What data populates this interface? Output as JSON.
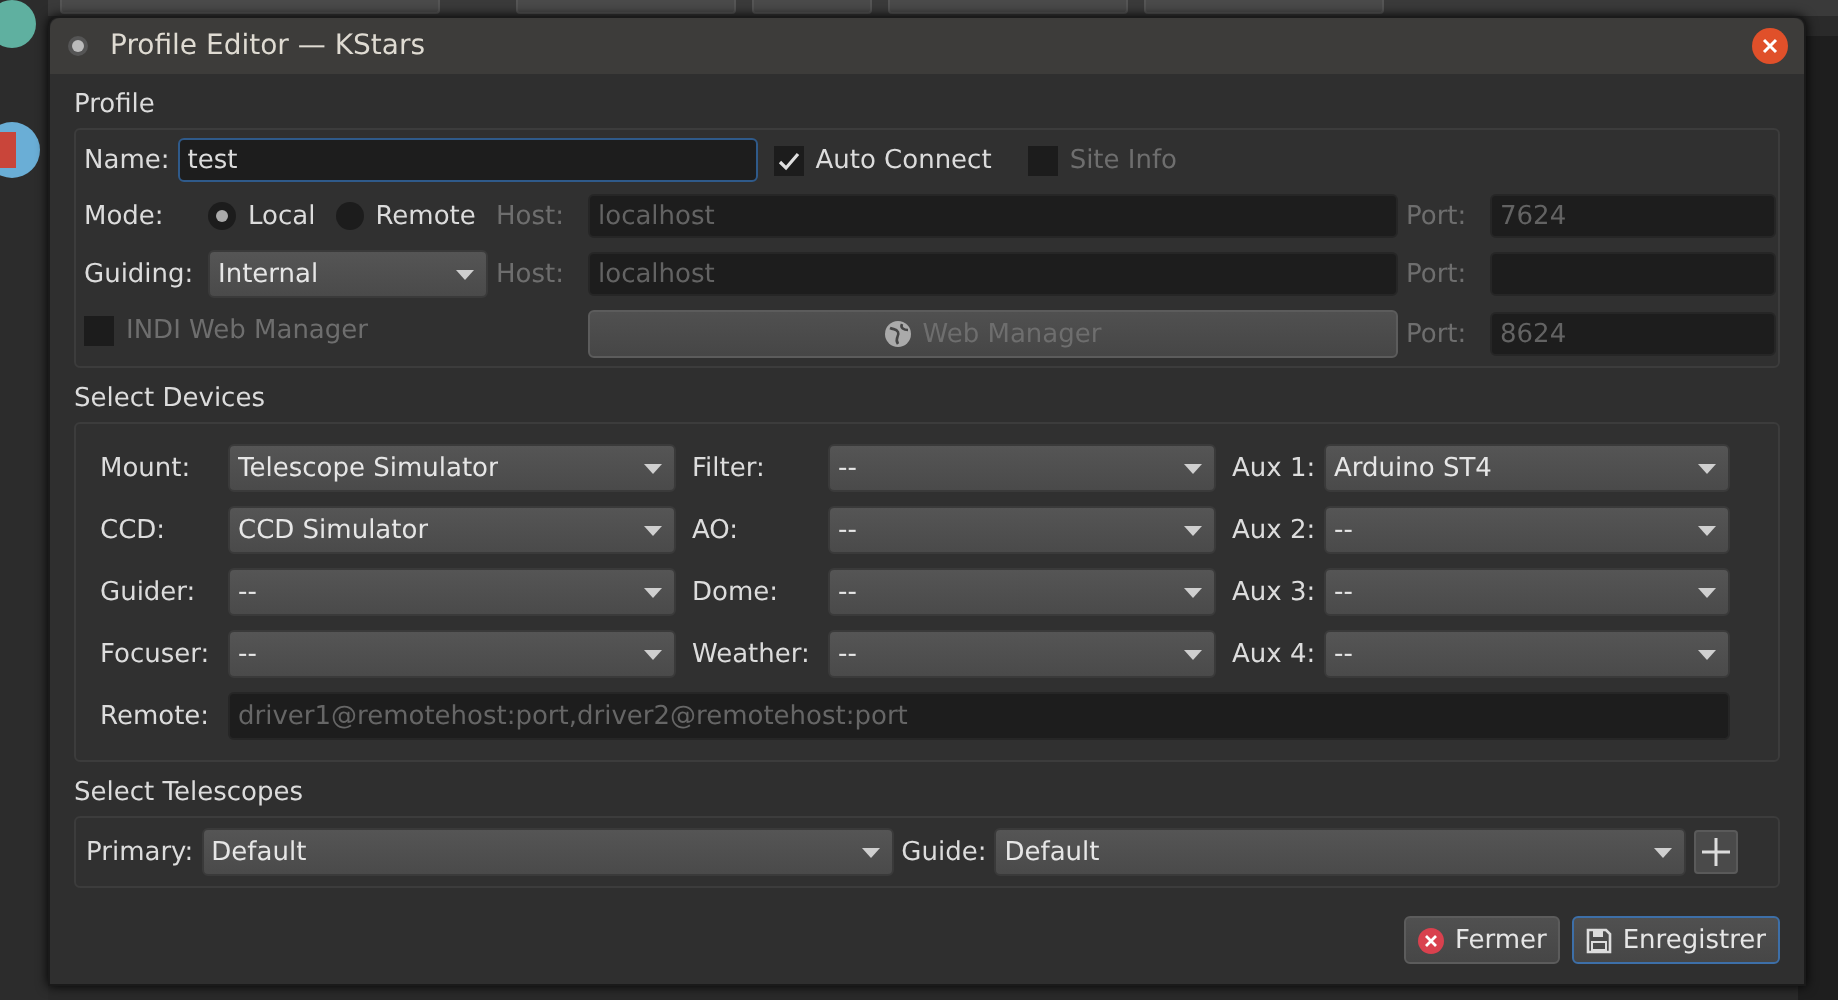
{
  "window": {
    "title": "Profile Editor — KStars"
  },
  "profile": {
    "title": "Profile",
    "name_label": "Name:",
    "name_value": "test",
    "auto_connect": {
      "label": "Auto Connect",
      "checked": true
    },
    "site_info": {
      "label": "Site Info",
      "checked": false,
      "disabled": true
    },
    "mode_label": "Mode:",
    "modes": [
      {
        "label": "Local",
        "selected": true
      },
      {
        "label": "Remote",
        "selected": false
      }
    ],
    "guiding_label": "Guiding:",
    "guiding_value": "Internal",
    "hosts": [
      {
        "label": "Host:",
        "placeholder": "localhost",
        "port_label": "Port:",
        "port_placeholder": "7624",
        "disabled": true
      },
      {
        "label": "Host:",
        "placeholder": "localhost",
        "port_label": "Port:",
        "disabled": true
      }
    ],
    "indi_web_manager": {
      "label": "INDI Web Manager",
      "checked": false,
      "disabled": true
    },
    "web_manager_button": {
      "label": "Web Manager",
      "disabled": true
    },
    "web_port": {
      "label": "Port:",
      "placeholder": "8624",
      "disabled": true
    }
  },
  "devices": {
    "title": "Select Devices",
    "rows": [
      [
        {
          "label": "Mount:",
          "value": "Telescope Simulator"
        },
        {
          "label": "Filter:",
          "value": "--"
        },
        {
          "label": "Aux 1:",
          "value": "Arduino ST4"
        }
      ],
      [
        {
          "label": "CCD:",
          "value": "CCD Simulator"
        },
        {
          "label": "AO:",
          "value": "--"
        },
        {
          "label": "Aux 2:",
          "value": "--"
        }
      ],
      [
        {
          "label": "Guider:",
          "value": "--"
        },
        {
          "label": "Dome:",
          "value": "--"
        },
        {
          "label": "Aux 3:",
          "value": "--"
        }
      ],
      [
        {
          "label": "Focuser:",
          "value": "--"
        },
        {
          "label": "Weather:",
          "value": "--"
        },
        {
          "label": "Aux 4:",
          "value": "--"
        }
      ]
    ],
    "remote_label": "Remote:",
    "remote_placeholder": "driver1@remotehost:port,driver2@remotehost:port"
  },
  "telescopes": {
    "title": "Select Telescopes",
    "primary_label": "Primary:",
    "primary_value": "Default",
    "guide_label": "Guide:",
    "guide_value": "Default"
  },
  "buttons": [
    {
      "label": "Fermer",
      "kind": "close",
      "default": false
    },
    {
      "label": "Enregistrer",
      "kind": "save",
      "default": true
    }
  ]
}
